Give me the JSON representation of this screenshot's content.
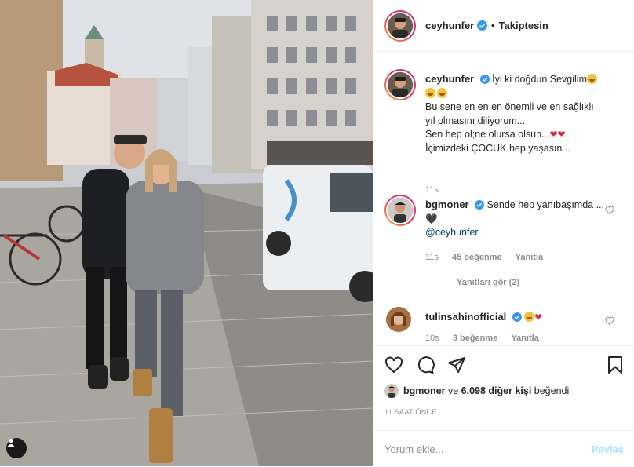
{
  "post": {
    "author": "ceyhunfer",
    "follow_state": "Takiptesin",
    "photo_alt": "Two people hugging and laughing on a cobblestone city street with a white van"
  },
  "caption": {
    "username": "ceyhunfer",
    "lines": [
      "İyi ki doğdun Sevgilim",
      "",
      "Bu sene en en en önemli ve en sağlıklı",
      "yıl olmasını diliyorum...",
      "Sen hep ol;ne olursa olsun...",
      "İçimizdeki ÇOCUK hep yaşasın..."
    ],
    "time": "11s"
  },
  "comments": [
    {
      "username": "bgmoner",
      "text": "Sende hep yanıbaşımda ... 🖤",
      "mention": "@ceyhunfer",
      "time": "11s",
      "likes": "45 beğenme",
      "reply": "Yanıtla",
      "view_replies": "Yanıtları gör (2)"
    },
    {
      "username": "tulinsahinofficial",
      "text": "",
      "time": "10s",
      "likes": "3 beğenme",
      "reply": "Yanıtla"
    }
  ],
  "likes_summary": {
    "first_liker": "bgmoner",
    "connector": "ve",
    "others": "6.098 diğer kişi",
    "suffix": "beğendi"
  },
  "timestamp": "11 SAAT ÖNCE",
  "add_comment": {
    "placeholder": "Yorum ekle...",
    "submit": "Paylaş"
  },
  "colors": {
    "verified_blue": "#3897f0",
    "link": "#00376b",
    "muted": "#8e8e8e",
    "share_disabled": "#b2dffc",
    "heart": "#d7263d"
  }
}
